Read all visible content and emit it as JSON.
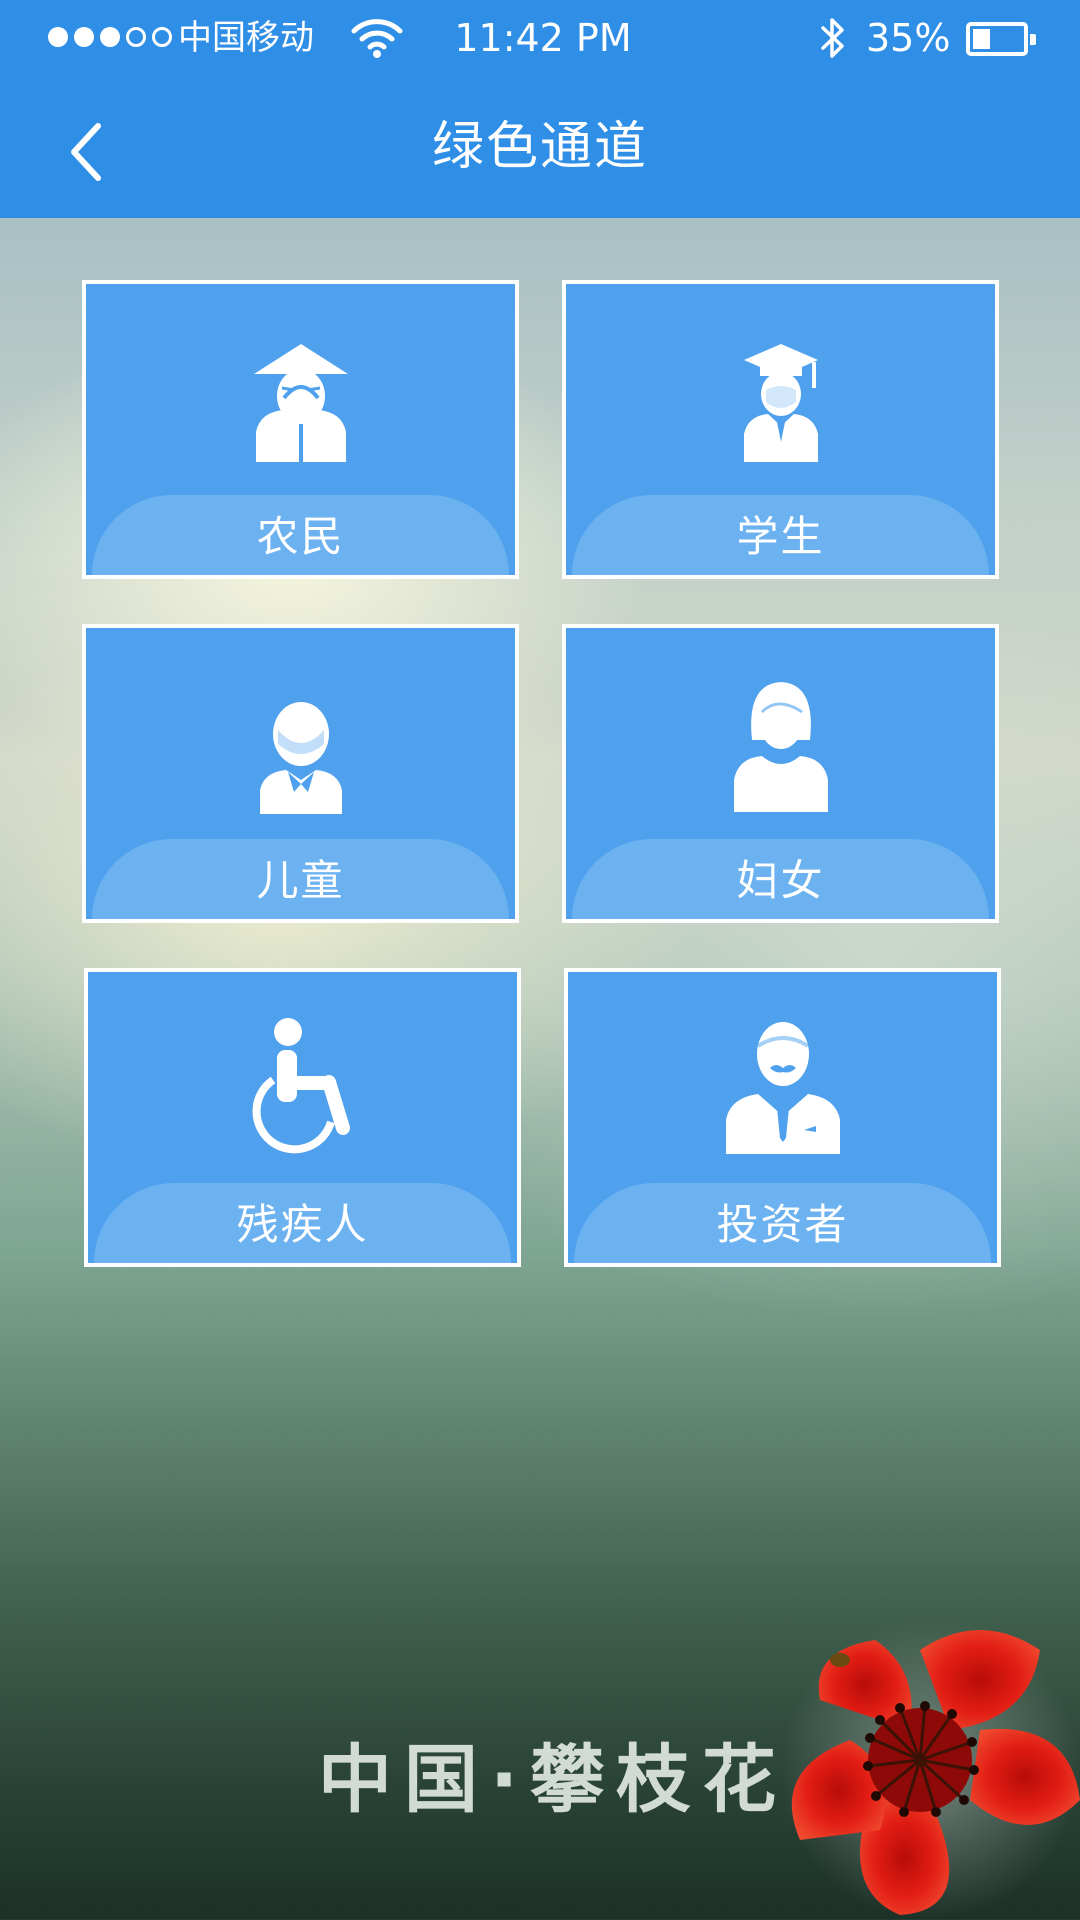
{
  "status_bar": {
    "carrier": "中国移动",
    "time": "11:42 PM",
    "battery_percent": "35%",
    "battery_level": 0.35,
    "signal_bars_filled": 3,
    "signal_bars_total": 5
  },
  "nav": {
    "title": "绿色通道",
    "back_icon": "chevron-left-icon"
  },
  "categories": [
    {
      "label": "农民",
      "icon": "farmer-icon"
    },
    {
      "label": "学生",
      "icon": "student-icon"
    },
    {
      "label": "儿童",
      "icon": "child-icon"
    },
    {
      "label": "妇女",
      "icon": "woman-icon"
    },
    {
      "label": "残疾人",
      "icon": "wheelchair-icon"
    },
    {
      "label": "投资者",
      "icon": "investor-icon"
    }
  ],
  "footer": {
    "brand_text": "中国·攀枝花"
  },
  "colors": {
    "header": "#2f8ee6",
    "tile": "#4fa1ee",
    "tile_band": "#6cb2f1",
    "tile_border": "#ffffff",
    "flower": "#e41e14"
  }
}
